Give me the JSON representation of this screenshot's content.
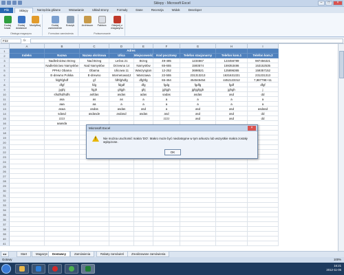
{
  "window": {
    "title": "Sklepy - Microsoft Excel"
  },
  "tabs": [
    "Plik",
    "Sklepy",
    "Narzędzia główne",
    "Wstawianie",
    "Układ strony",
    "Formuły",
    "Dane",
    "Recenzja",
    "Widok",
    "Developer"
  ],
  "ribbon": {
    "groups": [
      {
        "label": "Obsługa magazynu",
        "buttons": [
          "Dodaj towar",
          "Dodaj dostawce",
          "Modyfikuj"
        ]
      },
      {
        "label": "Formularz zamówienia",
        "buttons": [
          "Dodaj zamówienie",
          "Koszyk"
        ]
      },
      {
        "label": "Podsumowanie",
        "buttons": [
          "Archiwum",
          "Faktura",
          "Odejmij z magazynu"
        ]
      }
    ]
  },
  "formula_bar": {
    "name_box": "F22",
    "fx": "fx",
    "value": ""
  },
  "columns": [
    "A",
    "B",
    "C",
    "D",
    "E",
    "F",
    "G",
    "H",
    "I"
  ],
  "header_row2": [
    "Indeks",
    "Nazwa",
    "Nazwa skrótowa",
    "Ulica",
    "Miejscowość",
    "Kod pocztowy",
    "Telefon stacjonarny",
    "Telefon kom.1",
    "Telefon kom.2"
  ],
  "header_row1_text": "Adres",
  "rows": [
    [
      "",
      "Nadleśnictwo Brzeg",
      "Nad Brzeg",
      "Leśna 21",
      "Brzeg",
      "49-485",
      "1234567",
      "123456789",
      "987456321"
    ],
    [
      "",
      "Nadleśnictwo Namysłów",
      "Nad Namysłów",
      "Drzewna 14",
      "Namysłów",
      "65-655",
      "1593574",
      "159353486",
      "153152535"
    ],
    [
      "",
      "PPHU Obama",
      "Obama",
      "Ulicowa 11",
      "Waszyngton",
      "12-252",
      "3698521",
      "125896365",
      "159357152"
    ],
    [
      "",
      "E-drewno Polska",
      "E-drewno",
      "Internetowa12",
      "Warszawa",
      "22-555",
      "231313213",
      "1631631321",
      "231231313"
    ],
    [
      "",
      "fdghfghdf",
      "gf",
      "fdhfghdfg",
      "dfghfg",
      "65-454",
      "454545454",
      "4452123312",
      "7,88779E+11"
    ],
    [
      "",
      "dfgf",
      "fdg",
      "fdgdf",
      "dfg",
      "fgdg",
      "fgdfg",
      "fgdf",
      "dfgf"
    ],
    [
      "",
      "jyghj",
      "hjgh",
      "ghjgh",
      "ghj",
      "jghjgh",
      "jghjghjgh",
      "jghgh",
      "j"
    ],
    [
      "",
      "sfsdfsdfsdfs",
      "asfdas",
      "asdas",
      "adas",
      "sadas",
      "asdas",
      "asd",
      "dd"
    ],
    [
      "",
      "asa",
      "as",
      "as",
      "a",
      "a",
      "a",
      "a",
      "a"
    ],
    [
      "",
      "aaa",
      "aa",
      "a",
      "a",
      "a",
      "a",
      "a",
      "a"
    ],
    [
      "",
      "asaa",
      "asdas",
      "asdas",
      "asd",
      "a",
      "asd",
      "asd",
      "asdasd"
    ],
    [
      "",
      "sdasd",
      "asdasde",
      "asdasd",
      "asdas",
      "asd",
      "asd",
      "asd",
      "dd"
    ],
    [
      "",
      "zzzz",
      "",
      "",
      "",
      "zzzz",
      "asd",
      "asd",
      "dd"
    ],
    [
      "",
      "aaasda",
      "",
      "",
      "",
      "",
      "",
      "",
      ""
    ],
    [
      "",
      "",
      "",
      "",
      "",
      "",
      "",
      "",
      ""
    ],
    [
      "",
      "",
      "",
      "",
      "",
      "",
      "",
      "",
      ""
    ],
    [
      "",
      "",
      "",
      "",
      "",
      "",
      "",
      "",
      ""
    ]
  ],
  "row_numbers": [
    "1",
    "2",
    "3",
    "4",
    "5",
    "6",
    "7",
    "8",
    "9",
    "10",
    "11",
    "12",
    "13",
    "14",
    "15",
    "16",
    "17",
    "18",
    "19",
    "20",
    "21",
    "22",
    "23",
    "24",
    "25",
    "26",
    "27",
    "28",
    "29",
    "30",
    "31",
    "32",
    "33",
    "34",
    "35",
    "36",
    "37",
    "38",
    "39",
    "40",
    "41"
  ],
  "sheet_tabs": [
    "Start",
    "Magazyn",
    "Dostawcy",
    "Zamówienia",
    "Rabaty zamówień",
    "Zrealizowane zamówienia"
  ],
  "active_sheet": "Dostawcy",
  "status": {
    "left": "Gotowy",
    "zoom": "100%"
  },
  "dialog": {
    "title": "Microsoft Excel",
    "message": "Nie można uruchomić makra 'DO'. Makro może być niedostępne w tym arkuszu lub wszystkie makra zostały wyłączone.",
    "ok": "OK"
  },
  "taskbar": {
    "time": "16:21",
    "date": "2012-11-05"
  },
  "colors": {
    "header_fill": "#4f81bd",
    "accent": "#2a67b2",
    "warning": "#e8b600"
  }
}
